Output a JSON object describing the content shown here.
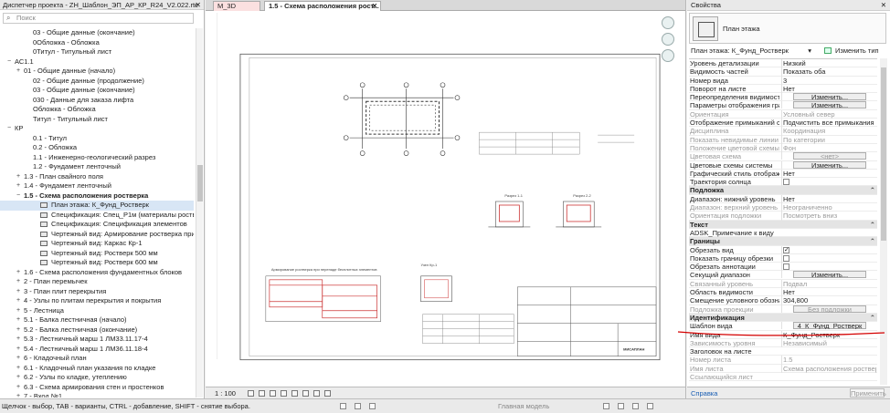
{
  "browser": {
    "title": "Диспетчер проекта - ZH_Шаблон_ЭП_АР_КР_R24_V2.022.rte",
    "close": "✕",
    "search_placeholder": "Поиск",
    "items": [
      {
        "label": "03 - Общие данные (окончание)",
        "level": 3,
        "exp": ""
      },
      {
        "label": "0Обложка - Обложка",
        "level": 3,
        "exp": ""
      },
      {
        "label": "0Титул - Титульный лист",
        "level": 3,
        "exp": ""
      },
      {
        "label": "АС1.1",
        "level": 1,
        "exp": "−"
      },
      {
        "label": "01 - Общие данные (начало)",
        "level": 2,
        "exp": "+"
      },
      {
        "label": "02 - Общие данные (продолжение)",
        "level": 3,
        "exp": ""
      },
      {
        "label": "03 - Общие данные (окончание)",
        "level": 3,
        "exp": ""
      },
      {
        "label": "030 - Данные для заказа лифта",
        "level": 3,
        "exp": ""
      },
      {
        "label": "Обложка - Обложка",
        "level": 3,
        "exp": ""
      },
      {
        "label": "Титул - Титульный лист",
        "level": 3,
        "exp": ""
      },
      {
        "label": "КР",
        "level": 1,
        "exp": "−"
      },
      {
        "label": "0.1 - Титул",
        "level": 3,
        "exp": ""
      },
      {
        "label": "0.2 - Обложка",
        "level": 3,
        "exp": ""
      },
      {
        "label": "1.1 - Инженерно-геологический разрез",
        "level": 3,
        "exp": ""
      },
      {
        "label": "1.2 - Фундамент ленточный",
        "level": 3,
        "exp": ""
      },
      {
        "label": "1.3 - План свайного поля",
        "level": 2,
        "exp": "+"
      },
      {
        "label": "1.4 - Фундамент ленточный",
        "level": 2,
        "exp": "+"
      },
      {
        "label": "1.5 - Схема расположения ростверка",
        "level": 2,
        "exp": "−",
        "bold": true
      },
      {
        "label": "План этажа: К_Фунд_Ростверк",
        "level": 4,
        "exp": "",
        "icon": true,
        "selected": true
      },
      {
        "label": "Спецификация: Спец_Р1м (материалы ростверк)",
        "level": 4,
        "exp": "",
        "icon": true
      },
      {
        "label": "Спецификация: Спецификация элементов",
        "level": 4,
        "exp": "",
        "icon": true
      },
      {
        "label": "Чертежный вид: Армирование ростверка при перепаде в",
        "level": 4,
        "exp": "",
        "icon": true
      },
      {
        "label": "Чертежный вид: Каркас Кр-1",
        "level": 4,
        "exp": "",
        "icon": true
      },
      {
        "label": "Чертежный вид: Ростверк 500 мм",
        "level": 4,
        "exp": "",
        "icon": true
      },
      {
        "label": "Чертежный вид: Ростверк 600 мм",
        "level": 4,
        "exp": "",
        "icon": true
      },
      {
        "label": "1.6 - Схема расположения фундаментных блоков",
        "level": 2,
        "exp": "+"
      },
      {
        "label": "2 - План перемычек",
        "level": 2,
        "exp": "+"
      },
      {
        "label": "3 - План плит перекрытия",
        "level": 2,
        "exp": "+"
      },
      {
        "label": "4 - Узлы по плитам перекрытия и покрытия",
        "level": 2,
        "exp": "+"
      },
      {
        "label": "5 - Лестница",
        "level": 2,
        "exp": "+"
      },
      {
        "label": "5.1 - Балка лестничная (начало)",
        "level": 2,
        "exp": "+"
      },
      {
        "label": "5.2 - Балка лестничная (окончание)",
        "level": 2,
        "exp": "+"
      },
      {
        "label": "5.3 - Лестничный марш 1 ЛМ33.11.17-4",
        "level": 2,
        "exp": "+"
      },
      {
        "label": "5.4 - Лестничный марш 1 ЛМ36.11.18-4",
        "level": 2,
        "exp": "+"
      },
      {
        "label": "6 - Кладочный план",
        "level": 2,
        "exp": "+"
      },
      {
        "label": "6.1 - Кладочный план указания по кладке",
        "level": 2,
        "exp": "+"
      },
      {
        "label": "6.2 - Узлы по кладке, утеплению",
        "level": 2,
        "exp": "+"
      },
      {
        "label": "6.3 - Схема армирования стен и простенков",
        "level": 2,
        "exp": "+"
      },
      {
        "label": "7 - Вход №1",
        "level": 2,
        "exp": "+"
      }
    ]
  },
  "tabs": [
    {
      "label": "M_3D"
    },
    {
      "label": "1.5 - Схема расположения рост..."
    }
  ],
  "tab_close": "✕",
  "viewbar": {
    "scale": "1 : 100"
  },
  "drawing_texts": {
    "t1": "Армирование ростверка при перепаде бесплитных элементов",
    "t2": "Разрез 1-1",
    "t3": "Разрез 2-2",
    "t4": "Узел Кр-1",
    "stamp": "МИСАПЛАН"
  },
  "props": {
    "title": "Свойства",
    "close": "✕",
    "type_name": "План этажа",
    "filter": "План этажа: К_Фунд_Ростверк",
    "edit_type": "Изменить тип",
    "rows": [
      {
        "kind": "text",
        "name": "Уровень детализации",
        "value": "Низкий"
      },
      {
        "kind": "text",
        "name": "Видимость частей",
        "value": "Показать оба"
      },
      {
        "kind": "text",
        "name": "Номер вида",
        "value": "3"
      },
      {
        "kind": "text",
        "name": "Поворот на листе",
        "value": "Нет"
      },
      {
        "kind": "btn",
        "name": "Переопределения видимости/г...",
        "value": "Изменить..."
      },
      {
        "kind": "btn",
        "name": "Параметры отображения граф...",
        "value": "Изменить..."
      },
      {
        "kind": "text",
        "name": "Ориентация",
        "value": "Условный север",
        "dis": true
      },
      {
        "kind": "text",
        "name": "Отображение примыканий стен",
        "value": "Подчистить все примыкания стен"
      },
      {
        "kind": "text",
        "name": "Дисциплина",
        "value": "Координация",
        "dis": true
      },
      {
        "kind": "text",
        "name": "Показать невидимые линии",
        "value": "По категории",
        "dis": true
      },
      {
        "kind": "text",
        "name": "Положение цветовой схемы",
        "value": "Фон",
        "dis": true
      },
      {
        "kind": "btn",
        "name": "Цветовая схема",
        "value": "<нет>",
        "dis": true
      },
      {
        "kind": "btn",
        "name": "Цветовые схемы системы",
        "value": "Изменить..."
      },
      {
        "kind": "text",
        "name": "Графический стиль отображен...",
        "value": "Нет"
      },
      {
        "kind": "cb",
        "name": "Траектория солнца",
        "value": false
      },
      {
        "kind": "group",
        "name": "Подложка"
      },
      {
        "kind": "text",
        "name": "Диапазон: нижний уровень",
        "value": "Нет"
      },
      {
        "kind": "text",
        "name": "Диапазон: верхний уровень",
        "value": "Неограниченно",
        "dis": true
      },
      {
        "kind": "text",
        "name": "Ориентация подложки",
        "value": "Посмотреть вниз",
        "dis": true
      },
      {
        "kind": "group",
        "name": "Текст"
      },
      {
        "kind": "text",
        "name": "ADSK_Примечание к виду",
        "value": ""
      },
      {
        "kind": "group",
        "name": "Границы"
      },
      {
        "kind": "cb",
        "name": "Обрезать вид",
        "value": true
      },
      {
        "kind": "cb",
        "name": "Показать границу обрезки",
        "value": false
      },
      {
        "kind": "cb",
        "name": "Обрезать аннотации",
        "value": false
      },
      {
        "kind": "btn",
        "name": "Секущий диапазон",
        "value": "Изменить..."
      },
      {
        "kind": "text",
        "name": "Связанный уровень",
        "value": "Подвал",
        "dis": true
      },
      {
        "kind": "text",
        "name": "Область видимости",
        "value": "Нет"
      },
      {
        "kind": "text",
        "name": "Смещение условного обозначе...",
        "value": "304,800"
      },
      {
        "kind": "btn",
        "name": "Подложка проекции",
        "value": "Без подложки",
        "dis": true
      },
      {
        "kind": "group",
        "name": "Идентификация"
      },
      {
        "kind": "btn",
        "name": "Шаблон вида",
        "value": "4_К_Фунд_Ростверк"
      },
      {
        "kind": "text",
        "name": "Имя вида",
        "value": "К_Фунд_Ростверк"
      },
      {
        "kind": "text",
        "name": "Зависимость уровня",
        "value": "Независимый",
        "dis": true
      },
      {
        "kind": "text",
        "name": "Заголовок на листе",
        "value": ""
      },
      {
        "kind": "text",
        "name": "Номер листа",
        "value": "1.5",
        "dis": true
      },
      {
        "kind": "text",
        "name": "Имя листа",
        "value": "Схема расположения ростверка",
        "dis": true
      },
      {
        "kind": "text",
        "name": "Ссылающийся лист",
        "value": "",
        "dis": true
      }
    ],
    "help": "Справка",
    "apply": "Применить"
  },
  "status": {
    "text": "Щелчок - выбор, TAB - варианты, CTRL - добавление, SHIFT - снятие выбора.",
    "model": "Главная модель"
  },
  "colors": {
    "annotation": "#d40000",
    "selection": "#d8e6f5"
  }
}
